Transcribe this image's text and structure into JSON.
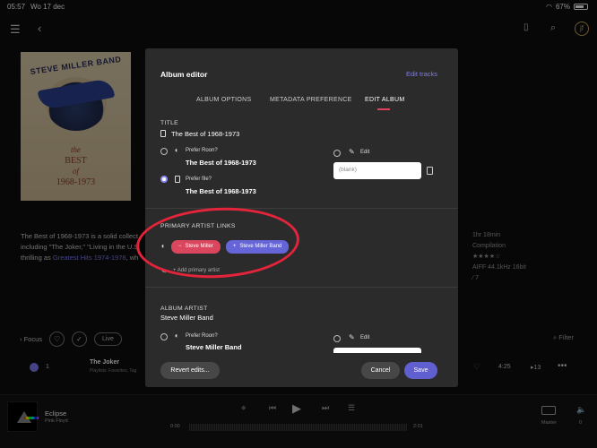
{
  "status": {
    "time": "05:57",
    "date": "Wo 17 dec",
    "battery": "67%"
  },
  "topbar": {
    "avatar_text": "jf"
  },
  "album": {
    "cover_band": "STEVE MILLER BAND",
    "cover_the": "the",
    "cover_best": "BEST",
    "cover_of": "of",
    "cover_years": "1968-1973",
    "description_line1": "The Best of 1968-1973 is a solid collect",
    "description_line2": "including \"The Joker,\" \"Living in the U.S.",
    "description_line3_prefix": "thrilling as ",
    "description_link": "Greatest Hits 1974-1978",
    "description_line3_suffix": ", wh",
    "meta": [
      "1hr 18min",
      "Compilation",
      "★★★★☆",
      "AIFF 44.1kHz 16bit",
      "∕ 7"
    ]
  },
  "focus": {
    "label": "Focus",
    "live": "Live",
    "filter": "Filter"
  },
  "track": {
    "number": "1",
    "title": "The Joker",
    "sub": "Playlists: Favorites, Tag",
    "duration": "4:25",
    "count": "13"
  },
  "player": {
    "title": "Eclipse",
    "artist": "Pink Floyd",
    "elapsed": "0:00",
    "total": "2:01",
    "zone": "Master",
    "volume": "0"
  },
  "modal": {
    "title": "Album editor",
    "edit_tracks": "Edit tracks",
    "tabs": [
      "ALBUM OPTIONS",
      "METADATA PREFERENCE",
      "EDIT ALBUM"
    ],
    "title_section": {
      "label": "TITLE",
      "current": "The Best of 1968-1973",
      "prefer_roon": "Prefer Roon?",
      "roon_value": "The Best of 1968-1973",
      "prefer_file": "Prefer file?",
      "file_value": "The Best of 1968-1973",
      "edit": "Edit",
      "blank_placeholder": "(blank)"
    },
    "primary_artist": {
      "label": "PRIMARY ARTIST LINKS",
      "chip_remove": "Steve Miller",
      "chip_add": "Steve Miller Band",
      "add_label": "Add primary artist"
    },
    "album_artist": {
      "label": "ALBUM ARTIST",
      "current": "Steve Miller Band",
      "prefer_roon": "Prefer Roon?",
      "roon_value": "Steve Miller Band",
      "edit": "Edit"
    },
    "buttons": {
      "revert": "Revert edits...",
      "cancel": "Cancel",
      "save": "Save"
    }
  }
}
